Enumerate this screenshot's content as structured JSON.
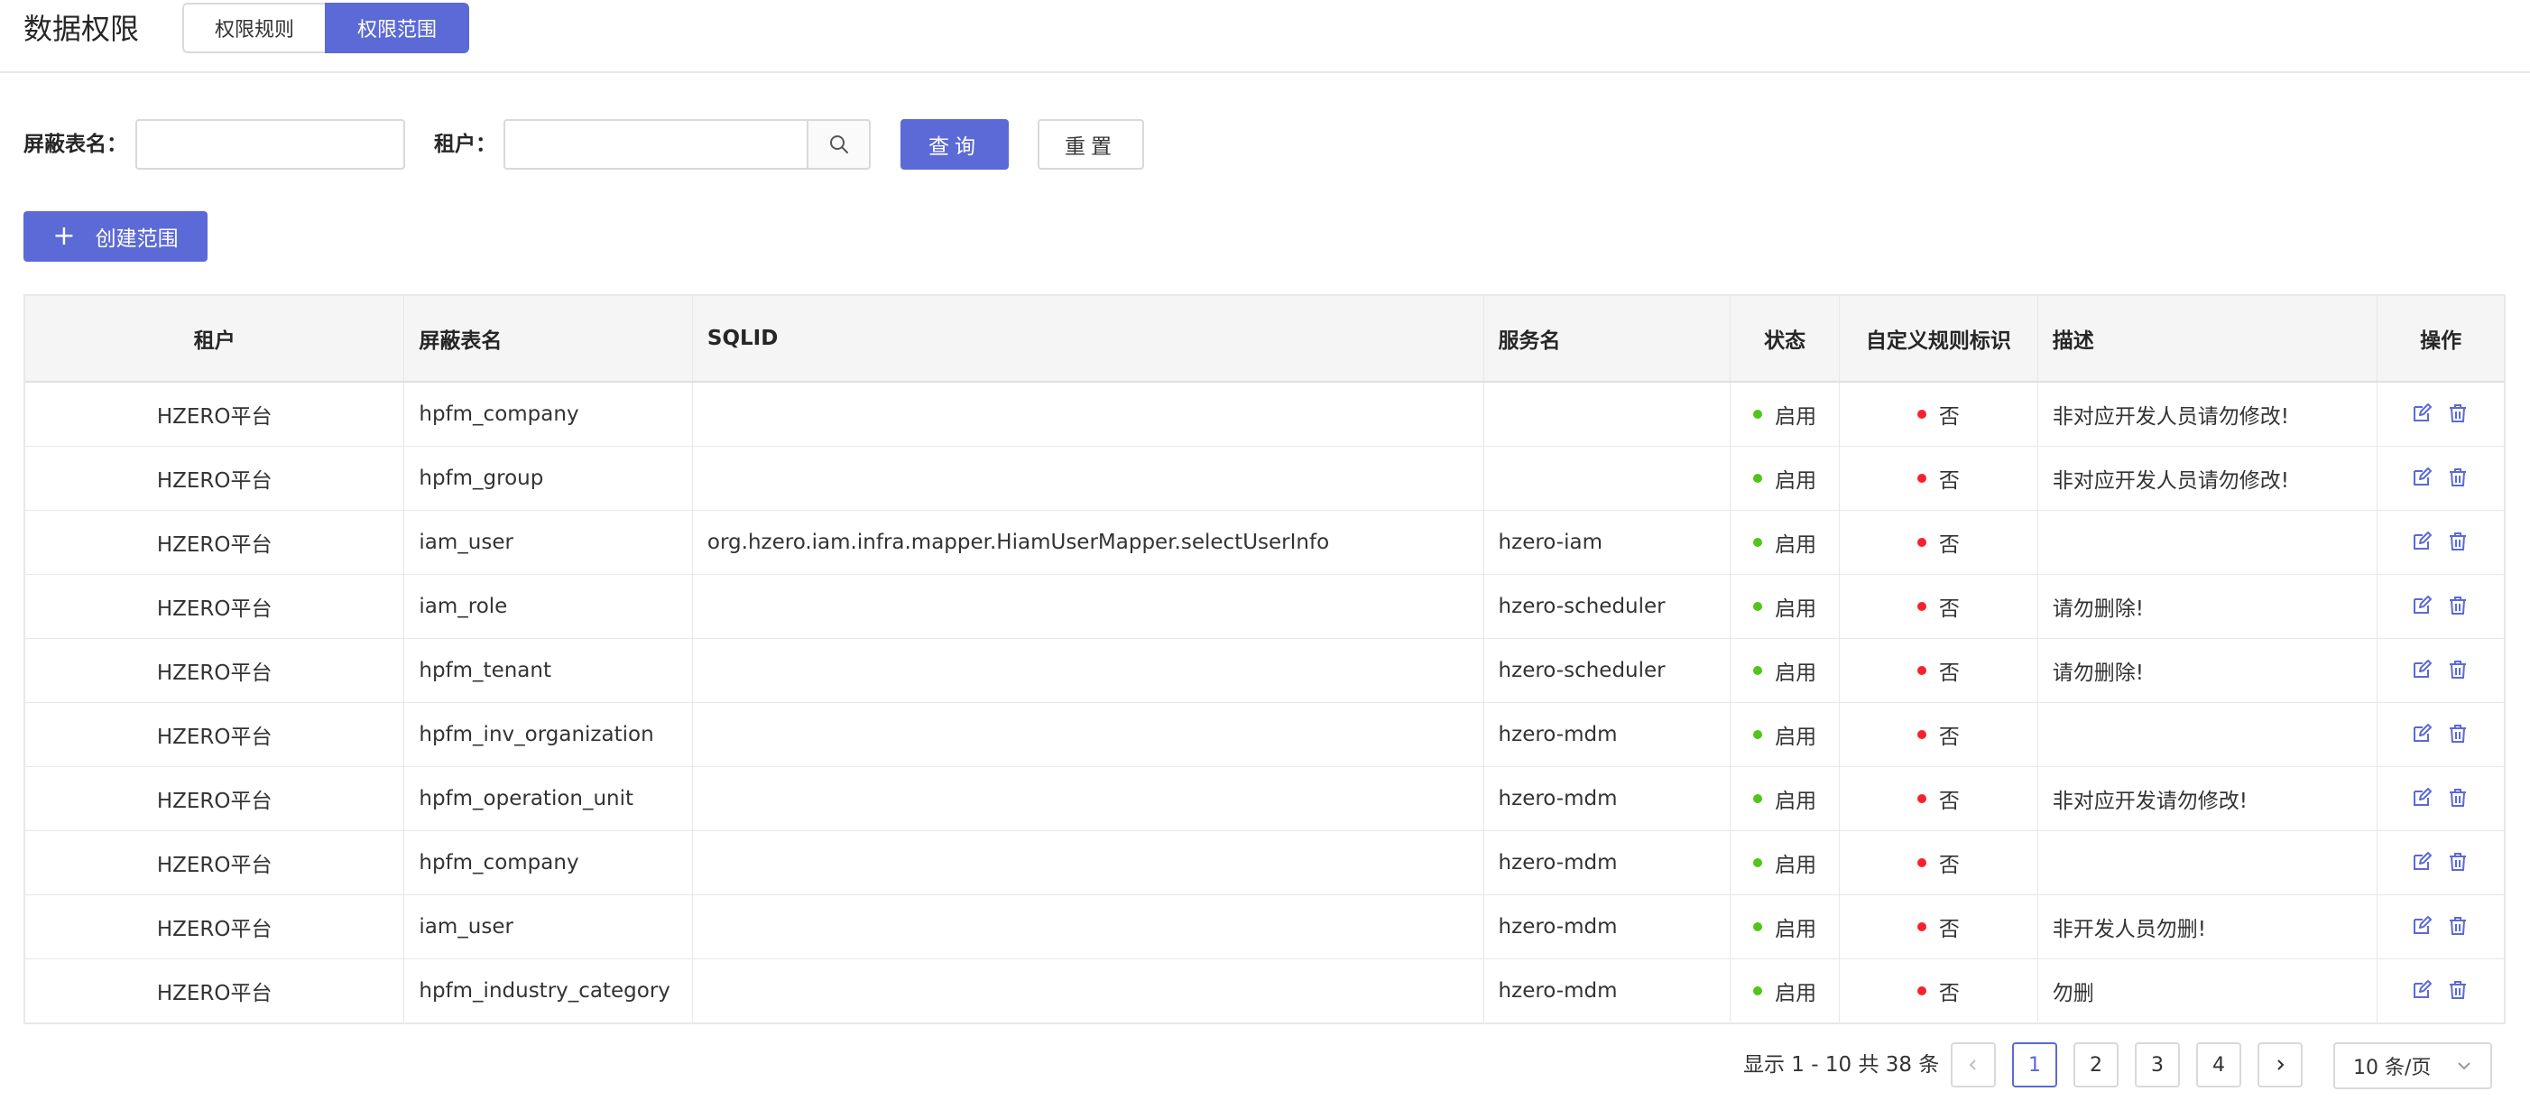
{
  "header": {
    "title": "数据权限",
    "tabs": [
      {
        "label": "权限规则"
      },
      {
        "label": "权限范围"
      }
    ]
  },
  "filters": {
    "table_label": "屏蔽表名：",
    "tenant_label": "租户：",
    "table_value": "",
    "tenant_value": "",
    "query_label": "查询",
    "reset_label": "重置"
  },
  "create_label": "创建范围",
  "table": {
    "columns": [
      "租户",
      "屏蔽表名",
      "SQLID",
      "服务名",
      "状态",
      "自定义规则标识",
      "描述",
      "操作"
    ],
    "rows": [
      {
        "tenant": "HZERO平台",
        "table": "hpfm_company",
        "sqlid": "",
        "service": "",
        "status": "启用",
        "custom": "否",
        "desc": "非对应开发人员请勿修改!"
      },
      {
        "tenant": "HZERO平台",
        "table": "hpfm_group",
        "sqlid": "",
        "service": "",
        "status": "启用",
        "custom": "否",
        "desc": "非对应开发人员请勿修改!"
      },
      {
        "tenant": "HZERO平台",
        "table": "iam_user",
        "sqlid": "org.hzero.iam.infra.mapper.HiamUserMapper.selectUserInfo",
        "service": "hzero-iam",
        "status": "启用",
        "custom": "否",
        "desc": ""
      },
      {
        "tenant": "HZERO平台",
        "table": "iam_role",
        "sqlid": "",
        "service": "hzero-scheduler",
        "status": "启用",
        "custom": "否",
        "desc": "请勿删除!"
      },
      {
        "tenant": "HZERO平台",
        "table": "hpfm_tenant",
        "sqlid": "",
        "service": "hzero-scheduler",
        "status": "启用",
        "custom": "否",
        "desc": "请勿删除!"
      },
      {
        "tenant": "HZERO平台",
        "table": "hpfm_inv_organization",
        "sqlid": "",
        "service": "hzero-mdm",
        "status": "启用",
        "custom": "否",
        "desc": ""
      },
      {
        "tenant": "HZERO平台",
        "table": "hpfm_operation_unit",
        "sqlid": "",
        "service": "hzero-mdm",
        "status": "启用",
        "custom": "否",
        "desc": "非对应开发请勿修改!"
      },
      {
        "tenant": "HZERO平台",
        "table": "hpfm_company",
        "sqlid": "",
        "service": "hzero-mdm",
        "status": "启用",
        "custom": "否",
        "desc": ""
      },
      {
        "tenant": "HZERO平台",
        "table": "iam_user",
        "sqlid": "",
        "service": "hzero-mdm",
        "status": "启用",
        "custom": "否",
        "desc": "非开发人员勿删!"
      },
      {
        "tenant": "HZERO平台",
        "table": "hpfm_industry_category",
        "sqlid": "",
        "service": "hzero-mdm",
        "status": "启用",
        "custom": "否",
        "desc": "勿删"
      }
    ]
  },
  "pagination": {
    "total_text": "显示 1 - 10 共 38 条",
    "pages": [
      "1",
      "2",
      "3",
      "4"
    ],
    "current": "1",
    "page_size": "10 条/页"
  },
  "icons": {
    "search": "search-icon",
    "plus": "plus-icon",
    "edit": "edit-icon",
    "delete": "trash-icon",
    "prev": "chevron-left-icon",
    "next": "chevron-right-icon",
    "dropdown": "chevron-down-icon"
  },
  "colors": {
    "primary": "#5b6ad6",
    "status_enabled": "#52c41a",
    "flag_no": "#f5222d",
    "header_bg": "#f5f5f5",
    "border": "#e8e8e8"
  }
}
